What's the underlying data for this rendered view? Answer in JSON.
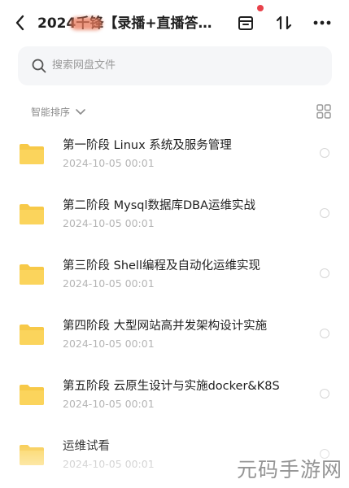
{
  "header": {
    "title": "2024千锋【录播+直播答…",
    "icons": [
      "back-arrow-icon",
      "archive-box-icon",
      "sort-arrows-icon",
      "more-icon"
    ],
    "notification_color": "#e8414a"
  },
  "search": {
    "placeholder": "搜索网盘文件"
  },
  "sort": {
    "label": "智能排序"
  },
  "files": [
    {
      "name": "第一阶段 Linux 系统及服务管理",
      "date": "2024-10-05   00:01"
    },
    {
      "name": "第二阶段 Mysql数据库DBA运维实战",
      "date": "2024-10-05   00:01"
    },
    {
      "name": "第三阶段 Shell编程及自动化运维实现",
      "date": "2024-10-05   00:01"
    },
    {
      "name": "第四阶段 大型网站高并发架构设计实施",
      "date": "2024-10-05   00:01"
    },
    {
      "name": "第五阶段 云原生设计与实施docker&K8S",
      "date": "2024-10-05   00:01"
    },
    {
      "name": "运维试看",
      "date": "2024-10-05   00:01"
    }
  ],
  "folder_color": "#f7c948",
  "watermark": "元码手游网"
}
